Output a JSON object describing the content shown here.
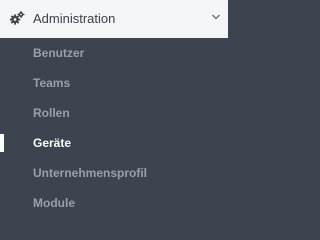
{
  "sidebar": {
    "section": {
      "title": "Administration",
      "icon": "gears-icon",
      "expand_icon": "chevron-down-icon",
      "expanded": true
    },
    "items": [
      {
        "label": "Benutzer",
        "active": false
      },
      {
        "label": "Teams",
        "active": false
      },
      {
        "label": "Rollen",
        "active": false
      },
      {
        "label": "Geräte",
        "active": true
      },
      {
        "label": "Unternehmensprofil",
        "active": false
      },
      {
        "label": "Module",
        "active": false
      }
    ]
  },
  "colors": {
    "sidebar_background": "#3d434f",
    "section_header_background": "#f4f5f7",
    "section_header_text": "#3b3f47",
    "item_text": "#9aa0ab",
    "active_item_text": "#ffffff",
    "active_indicator": "#ffffff"
  }
}
